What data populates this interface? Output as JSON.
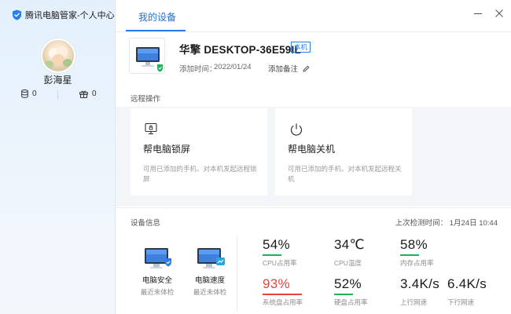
{
  "app": {
    "title": "腾讯电脑管家-个人中心"
  },
  "user": {
    "name": "彭海星",
    "stats": [
      {
        "icon": "database-icon",
        "value": "0"
      },
      {
        "icon": "gift-icon",
        "value": "0"
      }
    ]
  },
  "tabs": [
    {
      "label": "我的设备",
      "active": true
    }
  ],
  "device": {
    "name": "华擎 DESKTOP-36E59IL",
    "badge": "本机",
    "added_time_label": "添加时间：",
    "added_time_value": "2022/01/24",
    "add_remark": "添加备注"
  },
  "remote": {
    "section_label": "远程操作",
    "cards": [
      {
        "title": "帮电脑锁屏",
        "desc": "可用已添加的手机、对本机发起远程锁屏",
        "icon": "lock-screen-icon"
      },
      {
        "title": "帮电脑关机",
        "desc": "可用已添加的手机、对本机发起远程关机",
        "icon": "power-icon"
      }
    ]
  },
  "info": {
    "section_label": "设备信息",
    "last_check": "上次检测时间：   1月24日 10:44",
    "tiles": [
      {
        "title": "电脑安全",
        "sub": "最近未体检",
        "icon": "monitor-shield-icon"
      },
      {
        "title": "电脑速度",
        "sub": "最近未体检",
        "icon": "monitor-speed-icon"
      }
    ],
    "metrics": [
      {
        "value": "54%",
        "label": "CPU占用率",
        "color": "#22b05a"
      },
      {
        "value": "34℃",
        "label": "CPU温度",
        "color": ""
      },
      {
        "value": "58%",
        "label": "内存占用率",
        "color": "#22b05a"
      },
      {
        "value": "93%",
        "label": "系统盘占用率",
        "color": "#e7453a"
      },
      {
        "value": "52%",
        "label": "硬盘占用率",
        "color": "#22b05a"
      },
      {
        "value": "3.4K/s",
        "label": "上行网速",
        "color": ""
      },
      {
        "value": "6.4K/s",
        "label": "下行网速",
        "color": ""
      }
    ]
  },
  "colors": {
    "accent": "#2b7de9",
    "ok": "#22b05a",
    "warn": "#e7453a"
  }
}
